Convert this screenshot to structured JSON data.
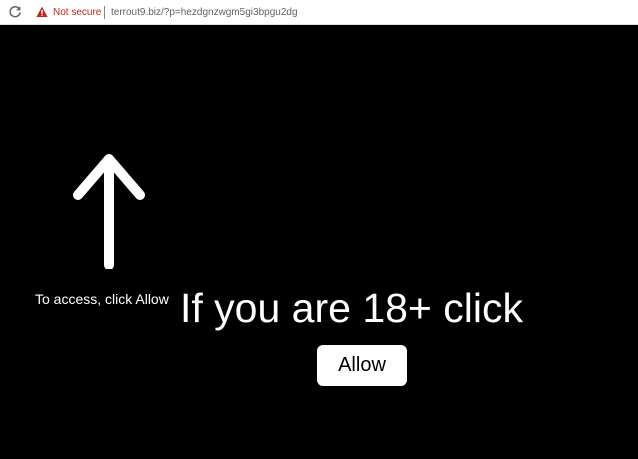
{
  "browser": {
    "security_label": "Not secure",
    "url": "terrout9.biz/?p=hezdgnzwgm5gi3bpgu2dg",
    "reload_icon": "reload-icon",
    "warning_icon": "warning-icon",
    "warning_color": "#c5221f"
  },
  "page": {
    "background_color": "#000000",
    "arrow_icon": "arrow-up-icon",
    "hint": "To access, click Allow",
    "headline": "If you are 18+ click",
    "allow_button_label": "Allow"
  }
}
